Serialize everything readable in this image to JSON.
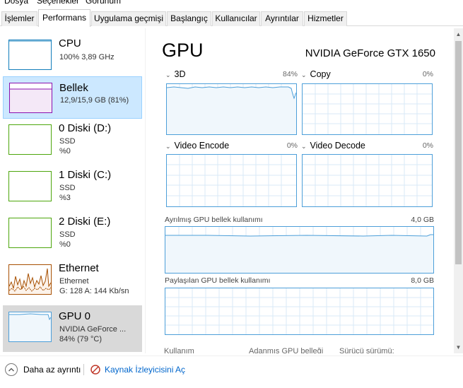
{
  "menu": [
    "Dosya",
    "Seçenekler",
    "Görünüm"
  ],
  "tabs": [
    "İşlemler",
    "Performans",
    "Uygulama geçmişi",
    "Başlangıç",
    "Kullanıcılar",
    "Ayrıntılar",
    "Hizmetler"
  ],
  "active_tab": "Performans",
  "sidebar": {
    "items": [
      {
        "title": "CPU",
        "line1": "100% 3,89 GHz",
        "line2": "",
        "level": 1.0
      },
      {
        "title": "Bellek",
        "line1": "12,9/15,9 GB (81%)",
        "line2": "",
        "level": 0.81
      },
      {
        "title": "0 Diski (D:)",
        "line1": "SSD",
        "line2": "%0",
        "level": 0
      },
      {
        "title": "1 Diski (C:)",
        "line1": "SSD",
        "line2": "%3",
        "level": 0.03
      },
      {
        "title": "2 Diski (E:)",
        "line1": "SSD",
        "line2": "%0",
        "level": 0
      },
      {
        "title": "Ethernet",
        "line1": "Ethernet",
        "line2": "G: 128 A: 144 Kb/sn",
        "level": null
      },
      {
        "title": "GPU 0",
        "line1": "NVIDIA GeForce ...",
        "line2": "84% (79 °C)",
        "level": 0.84
      }
    ]
  },
  "main": {
    "title": "GPU",
    "model": "NVIDIA GeForce GTX 1650",
    "engines": [
      {
        "name": "3D",
        "percent": "84%",
        "level": 0.84
      },
      {
        "name": "Copy",
        "percent": "0%",
        "level": 0
      },
      {
        "name": "Video Encode",
        "percent": "0%",
        "level": 0
      },
      {
        "name": "Video Decode",
        "percent": "0%",
        "level": 0
      }
    ],
    "dedicated_memory": {
      "label": "Ayrılmış GPU bellek kullanımı",
      "max": "4,0 GB",
      "level": 0.72
    },
    "shared_memory": {
      "label": "Paylaşılan GPU bellek kullanımı",
      "max": "8,0 GB",
      "level": 0
    },
    "stats_labels": [
      "Kullanım",
      "Adanmış GPU belleği",
      "Sürücü sürümü:"
    ]
  },
  "footer": {
    "fewer_details": "Daha az ayrıntı",
    "resource_monitor": "Kaynak İzleyicisini Aç"
  },
  "colors": {
    "gpu_accent": "#4d9fd9",
    "gpu_fill": "#f0f7fc",
    "memory_accent": "#8b12ae",
    "memory_fill": "#f4e8f7",
    "disk_accent": "#4da60c",
    "ethernet_accent": "#a74f01",
    "ethernet_fill": "#fcf3eb",
    "cpu_accent": "#117dbb",
    "cpu_fill": "#f1f6fa",
    "grid": "#d9eaf7",
    "link": "#0066cc"
  },
  "icons": {
    "fewer_details": "chevron-up-icon",
    "resource_monitor": "resource-monitor-icon",
    "engine_dropdown": "chevron-down-icon"
  }
}
